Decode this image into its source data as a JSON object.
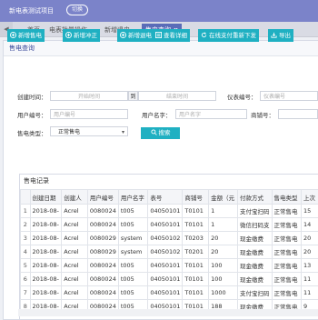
{
  "topbar": {
    "title": "新电表测试项目",
    "switch_label": "切换"
  },
  "tabs": [
    {
      "label": "首页"
    },
    {
      "label": "电表批量操作"
    },
    {
      "label": "新增退电"
    },
    {
      "label": "售电查询",
      "active": true
    }
  ],
  "panel": {
    "title": "售电查询"
  },
  "toolbar": [
    {
      "label": "新增售电",
      "icon": "plus-icon"
    },
    {
      "label": "新增冲正",
      "icon": "plus-icon"
    },
    {
      "label": "新增退电",
      "icon": "plus-icon"
    },
    {
      "label": "查看详细",
      "icon": "view-icon"
    },
    {
      "label": "在线支付重新下发",
      "icon": "refresh-icon"
    },
    {
      "label": "导出",
      "icon": "export-icon"
    }
  ],
  "filters": {
    "create_time_label": "创建时间：",
    "start_placeholder": "开始时间",
    "to_label": "到",
    "end_placeholder": "结束时间",
    "meter_no_label": "仪表编号：",
    "meter_no_placeholder": "仪表编号",
    "user_no_label": "用户编号：",
    "user_no_placeholder": "用户编号",
    "user_name_label": "用户名字：",
    "user_name_placeholder": "用户名字",
    "shop_no_label": "商铺号：",
    "sale_type_label": "售电类型：",
    "sale_type_value": "正常售电",
    "search_label": "搜索"
  },
  "records": {
    "title": "售电记录",
    "columns": [
      "",
      "创建日期",
      "创建人",
      "用户编号",
      "用户名字",
      "表号",
      "商铺号",
      "金额（元",
      "付款方式",
      "售电类型",
      "上次"
    ],
    "rows": [
      [
        "1",
        "2018-08-",
        "Acrel",
        "0080024",
        "t005",
        "04050101",
        "T0101",
        "1",
        "支付宝扫码",
        "正常售电",
        "15"
      ],
      [
        "2",
        "2018-08-",
        "Acrel",
        "0080024",
        "t005",
        "04050101",
        "T0101",
        "1",
        "微信扫码支",
        "正常售电",
        "14"
      ],
      [
        "3",
        "2018-08-",
        "Acrel",
        "0080029",
        "system",
        "04050102",
        "T0203",
        "20",
        "现金缴费",
        "正常售电",
        "20"
      ],
      [
        "4",
        "2018-08-",
        "Acrel",
        "0080029",
        "system",
        "04050102",
        "T0201",
        "20",
        "现金缴费",
        "正常售电",
        "20"
      ],
      [
        "5",
        "2018-08-",
        "Acrel",
        "0080024",
        "t005",
        "04050101",
        "T0101",
        "100",
        "现金缴费",
        "正常售电",
        "13"
      ],
      [
        "6",
        "2018-08-",
        "Acrel",
        "0080024",
        "t005",
        "04050101",
        "T0101",
        "100",
        "现金缴费",
        "正常售电",
        "11"
      ],
      [
        "7",
        "2018-08-",
        "Acrel",
        "0080024",
        "t005",
        "04050101",
        "T0101",
        "1000",
        "支付宝扫码",
        "正常售电",
        "11"
      ],
      [
        "8",
        "2018-08-",
        "Acrel",
        "0080024",
        "t005",
        "04050101",
        "T0101",
        "188",
        "现金缴费",
        "正常售电",
        "9"
      ]
    ]
  },
  "colors": {
    "topbar": "#7b83c9",
    "accent": "#1fb0c2",
    "active_tab": "#5a6cb8"
  }
}
